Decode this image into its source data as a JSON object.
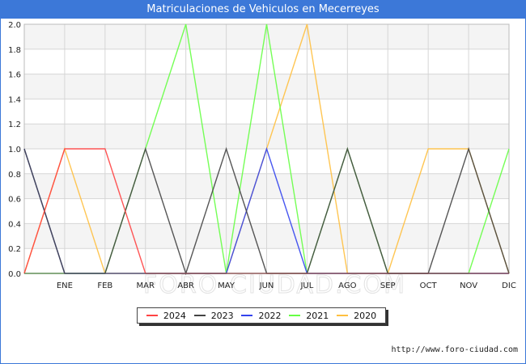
{
  "title": "Matriculaciones de Vehiculos en Mecerreyes",
  "watermark": "FORO-CIUDAD.COM",
  "source_url": "http://www.foro-ciudad.com",
  "chart_data": {
    "type": "line",
    "x_points": [
      "",
      "ENE",
      "FEB",
      "MAR",
      "ABR",
      "MAY",
      "JUN",
      "JUL",
      "AGO",
      "SEP",
      "OCT",
      "NOV",
      "DIC"
    ],
    "categories": [
      "ENE",
      "FEB",
      "MAR",
      "ABR",
      "MAY",
      "JUN",
      "JUL",
      "AGO",
      "SEP",
      "OCT",
      "NOV",
      "DIC"
    ],
    "ylim": [
      0,
      2.0
    ],
    "yticks": [
      "0.0",
      "0.2",
      "0.4",
      "0.6",
      "0.8",
      "1.0",
      "1.2",
      "1.4",
      "1.6",
      "1.8",
      "2.0"
    ],
    "grid": true,
    "legend_position": "bottom-center",
    "series": [
      {
        "name": "2020",
        "color": "#ffc040",
        "values": [
          0,
          1,
          0,
          0,
          0,
          0,
          1,
          2,
          0,
          0,
          1,
          1,
          0
        ]
      },
      {
        "name": "2021",
        "color": "#66ff44",
        "values": [
          0,
          0,
          0,
          1,
          2,
          0,
          2,
          0,
          1,
          0,
          0,
          0,
          1
        ]
      },
      {
        "name": "2022",
        "color": "#3344ee",
        "values": [
          1,
          0,
          0,
          0,
          0,
          0,
          1,
          0,
          0,
          0,
          0,
          0,
          0
        ]
      },
      {
        "name": "2023",
        "color": "#444444",
        "values": [
          1,
          0,
          0,
          1,
          0,
          1,
          0,
          0,
          1,
          0,
          0,
          1,
          0
        ]
      },
      {
        "name": "2024",
        "color": "#ff4444",
        "values": [
          0,
          1,
          1,
          0,
          0,
          0,
          0,
          0,
          0,
          0,
          0,
          0,
          0
        ]
      }
    ],
    "legend": [
      {
        "label": "2024",
        "color": "#ff4444"
      },
      {
        "label": "2023",
        "color": "#444444"
      },
      {
        "label": "2022",
        "color": "#3344ee"
      },
      {
        "label": "2021",
        "color": "#66ff44"
      },
      {
        "label": "2020",
        "color": "#ffc040"
      }
    ]
  }
}
